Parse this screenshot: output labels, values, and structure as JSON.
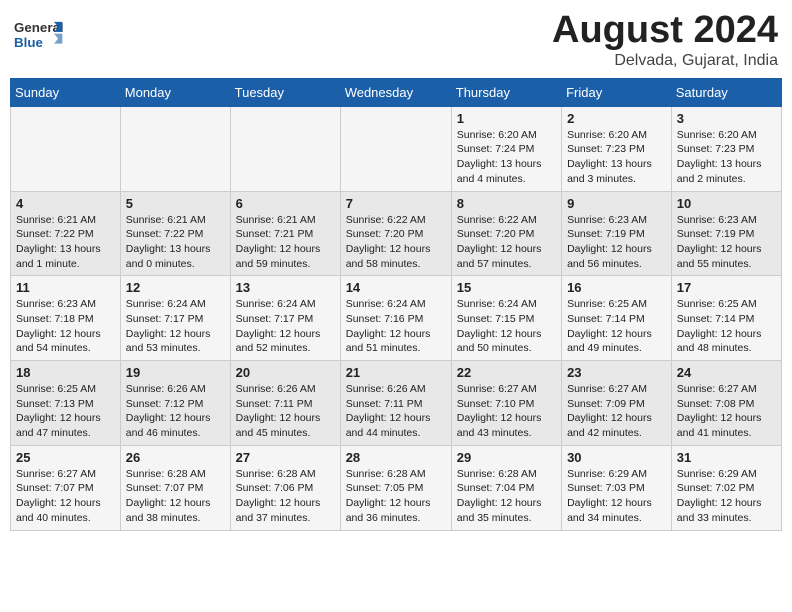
{
  "header": {
    "logo_general": "General",
    "logo_blue": "Blue",
    "month_title": "August 2024",
    "location": "Delvada, Gujarat, India"
  },
  "weekdays": [
    "Sunday",
    "Monday",
    "Tuesday",
    "Wednesday",
    "Thursday",
    "Friday",
    "Saturday"
  ],
  "weeks": [
    [
      {
        "day": "",
        "info": ""
      },
      {
        "day": "",
        "info": ""
      },
      {
        "day": "",
        "info": ""
      },
      {
        "day": "",
        "info": ""
      },
      {
        "day": "1",
        "info": "Sunrise: 6:20 AM\nSunset: 7:24 PM\nDaylight: 13 hours\nand 4 minutes."
      },
      {
        "day": "2",
        "info": "Sunrise: 6:20 AM\nSunset: 7:23 PM\nDaylight: 13 hours\nand 3 minutes."
      },
      {
        "day": "3",
        "info": "Sunrise: 6:20 AM\nSunset: 7:23 PM\nDaylight: 13 hours\nand 2 minutes."
      }
    ],
    [
      {
        "day": "4",
        "info": "Sunrise: 6:21 AM\nSunset: 7:22 PM\nDaylight: 13 hours\nand 1 minute."
      },
      {
        "day": "5",
        "info": "Sunrise: 6:21 AM\nSunset: 7:22 PM\nDaylight: 13 hours\nand 0 minutes."
      },
      {
        "day": "6",
        "info": "Sunrise: 6:21 AM\nSunset: 7:21 PM\nDaylight: 12 hours\nand 59 minutes."
      },
      {
        "day": "7",
        "info": "Sunrise: 6:22 AM\nSunset: 7:20 PM\nDaylight: 12 hours\nand 58 minutes."
      },
      {
        "day": "8",
        "info": "Sunrise: 6:22 AM\nSunset: 7:20 PM\nDaylight: 12 hours\nand 57 minutes."
      },
      {
        "day": "9",
        "info": "Sunrise: 6:23 AM\nSunset: 7:19 PM\nDaylight: 12 hours\nand 56 minutes."
      },
      {
        "day": "10",
        "info": "Sunrise: 6:23 AM\nSunset: 7:19 PM\nDaylight: 12 hours\nand 55 minutes."
      }
    ],
    [
      {
        "day": "11",
        "info": "Sunrise: 6:23 AM\nSunset: 7:18 PM\nDaylight: 12 hours\nand 54 minutes."
      },
      {
        "day": "12",
        "info": "Sunrise: 6:24 AM\nSunset: 7:17 PM\nDaylight: 12 hours\nand 53 minutes."
      },
      {
        "day": "13",
        "info": "Sunrise: 6:24 AM\nSunset: 7:17 PM\nDaylight: 12 hours\nand 52 minutes."
      },
      {
        "day": "14",
        "info": "Sunrise: 6:24 AM\nSunset: 7:16 PM\nDaylight: 12 hours\nand 51 minutes."
      },
      {
        "day": "15",
        "info": "Sunrise: 6:24 AM\nSunset: 7:15 PM\nDaylight: 12 hours\nand 50 minutes."
      },
      {
        "day": "16",
        "info": "Sunrise: 6:25 AM\nSunset: 7:14 PM\nDaylight: 12 hours\nand 49 minutes."
      },
      {
        "day": "17",
        "info": "Sunrise: 6:25 AM\nSunset: 7:14 PM\nDaylight: 12 hours\nand 48 minutes."
      }
    ],
    [
      {
        "day": "18",
        "info": "Sunrise: 6:25 AM\nSunset: 7:13 PM\nDaylight: 12 hours\nand 47 minutes."
      },
      {
        "day": "19",
        "info": "Sunrise: 6:26 AM\nSunset: 7:12 PM\nDaylight: 12 hours\nand 46 minutes."
      },
      {
        "day": "20",
        "info": "Sunrise: 6:26 AM\nSunset: 7:11 PM\nDaylight: 12 hours\nand 45 minutes."
      },
      {
        "day": "21",
        "info": "Sunrise: 6:26 AM\nSunset: 7:11 PM\nDaylight: 12 hours\nand 44 minutes."
      },
      {
        "day": "22",
        "info": "Sunrise: 6:27 AM\nSunset: 7:10 PM\nDaylight: 12 hours\nand 43 minutes."
      },
      {
        "day": "23",
        "info": "Sunrise: 6:27 AM\nSunset: 7:09 PM\nDaylight: 12 hours\nand 42 minutes."
      },
      {
        "day": "24",
        "info": "Sunrise: 6:27 AM\nSunset: 7:08 PM\nDaylight: 12 hours\nand 41 minutes."
      }
    ],
    [
      {
        "day": "25",
        "info": "Sunrise: 6:27 AM\nSunset: 7:07 PM\nDaylight: 12 hours\nand 40 minutes."
      },
      {
        "day": "26",
        "info": "Sunrise: 6:28 AM\nSunset: 7:07 PM\nDaylight: 12 hours\nand 38 minutes."
      },
      {
        "day": "27",
        "info": "Sunrise: 6:28 AM\nSunset: 7:06 PM\nDaylight: 12 hours\nand 37 minutes."
      },
      {
        "day": "28",
        "info": "Sunrise: 6:28 AM\nSunset: 7:05 PM\nDaylight: 12 hours\nand 36 minutes."
      },
      {
        "day": "29",
        "info": "Sunrise: 6:28 AM\nSunset: 7:04 PM\nDaylight: 12 hours\nand 35 minutes."
      },
      {
        "day": "30",
        "info": "Sunrise: 6:29 AM\nSunset: 7:03 PM\nDaylight: 12 hours\nand 34 minutes."
      },
      {
        "day": "31",
        "info": "Sunrise: 6:29 AM\nSunset: 7:02 PM\nDaylight: 12 hours\nand 33 minutes."
      }
    ]
  ]
}
